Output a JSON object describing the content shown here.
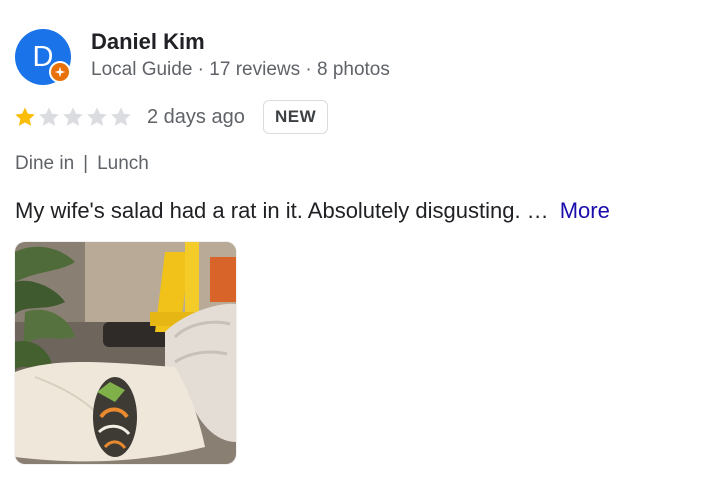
{
  "reviewer": {
    "initial": "D",
    "name": "Daniel Kim",
    "meta": "Local Guide · 17 reviews · 8 photos",
    "avatar_color": "#1a73e8",
    "badge_color": "#e8710a",
    "badge_icon": "local-guide-star-icon"
  },
  "rating": {
    "value": 1,
    "max": 5,
    "filled_color": "#fbbc04",
    "empty_color": "#dadce0"
  },
  "date": "2 days ago",
  "badge_new": "NEW",
  "tags": {
    "service": "Dine in",
    "separator": "|",
    "meal": "Lunch"
  },
  "review_text": "My wife's salad had a rat in it. Absolutely disgusting. …",
  "more_label": "More",
  "more_color": "#1a0dab"
}
